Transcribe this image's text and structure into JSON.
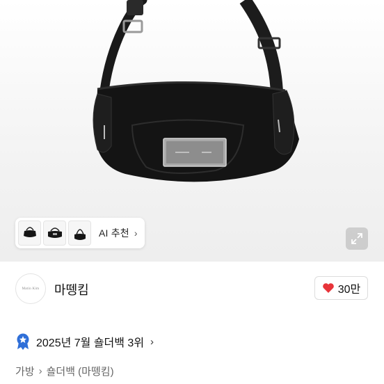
{
  "product_image": {
    "description_icon": "shoulder-bag-image"
  },
  "ai_recommend": {
    "label": "AI 추천",
    "chevron": "›",
    "thumbnails": [
      "bag-thumb-1",
      "bag-thumb-2",
      "bag-thumb-3"
    ]
  },
  "expand": {
    "icon": "expand-icon"
  },
  "seller": {
    "avatar_text": "Matin Kim",
    "name": "마뗑킴",
    "likes": "30만",
    "colors": {
      "heart": "#e8343a"
    }
  },
  "ranking": {
    "text": "2025년 7월 숄더백 3위",
    "chevron": "›",
    "badge_color": "#2f6fd8"
  },
  "breadcrumb": {
    "items": [
      "가방",
      "숄더백 (마뗑킴)"
    ],
    "separator": "›"
  }
}
